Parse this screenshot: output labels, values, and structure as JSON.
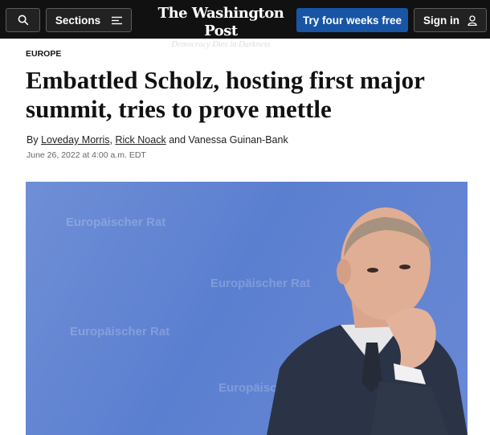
{
  "header": {
    "sections_label": "Sections",
    "brand_name": "The Washington Post",
    "brand_tagline": "Democracy Dies in Darkness",
    "subscribe_label": "Try four weeks free",
    "signin_label": "Sign in",
    "icons": [
      "search-icon",
      "menu-icon",
      "user-icon"
    ],
    "colors": {
      "bar": "#111111",
      "subscribe": "#1955a5"
    }
  },
  "article": {
    "kicker": "EUROPE",
    "headline": "Embattled Scholz, hosting first major summit, tries to prove mettle",
    "byline": {
      "prefix": "By",
      "authors": [
        "Loveday Morris",
        "Rick Noack"
      ],
      "separator": ",",
      "conjunction": "and",
      "last_author": "Vanessa Guinan-Bank"
    },
    "date": "June 26, 2022 at 4:00 a.m. EDT"
  },
  "photo": {
    "background_text": [
      "Europäischer Rat",
      "Europäischer Rat",
      "Europäischer Rat",
      "Europäischer Rat"
    ]
  }
}
